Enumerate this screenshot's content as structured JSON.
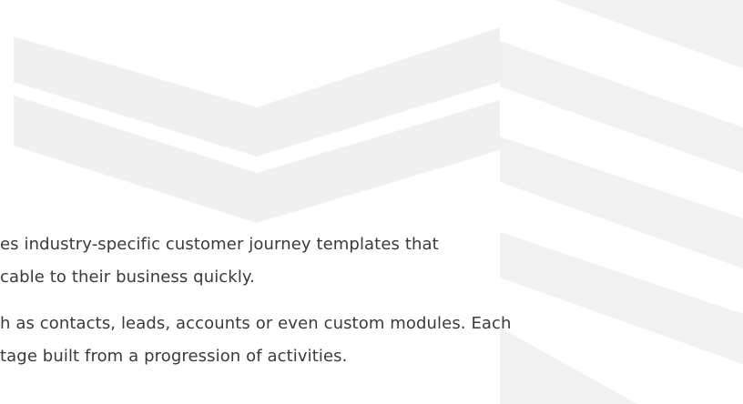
{
  "background": {
    "color": "#ffffff",
    "pattern_color": "#efefef",
    "pattern_icon": "chevron-stripes-icon"
  },
  "text": {
    "paragraph_1": {
      "line_1": "es industry-specific customer journey templates that",
      "line_2": "cable to their business quickly."
    },
    "paragraph_2": {
      "line_1": "h as contacts, leads, accounts or even custom modules. Each",
      "line_2": "tage built from a progression of activities."
    }
  }
}
